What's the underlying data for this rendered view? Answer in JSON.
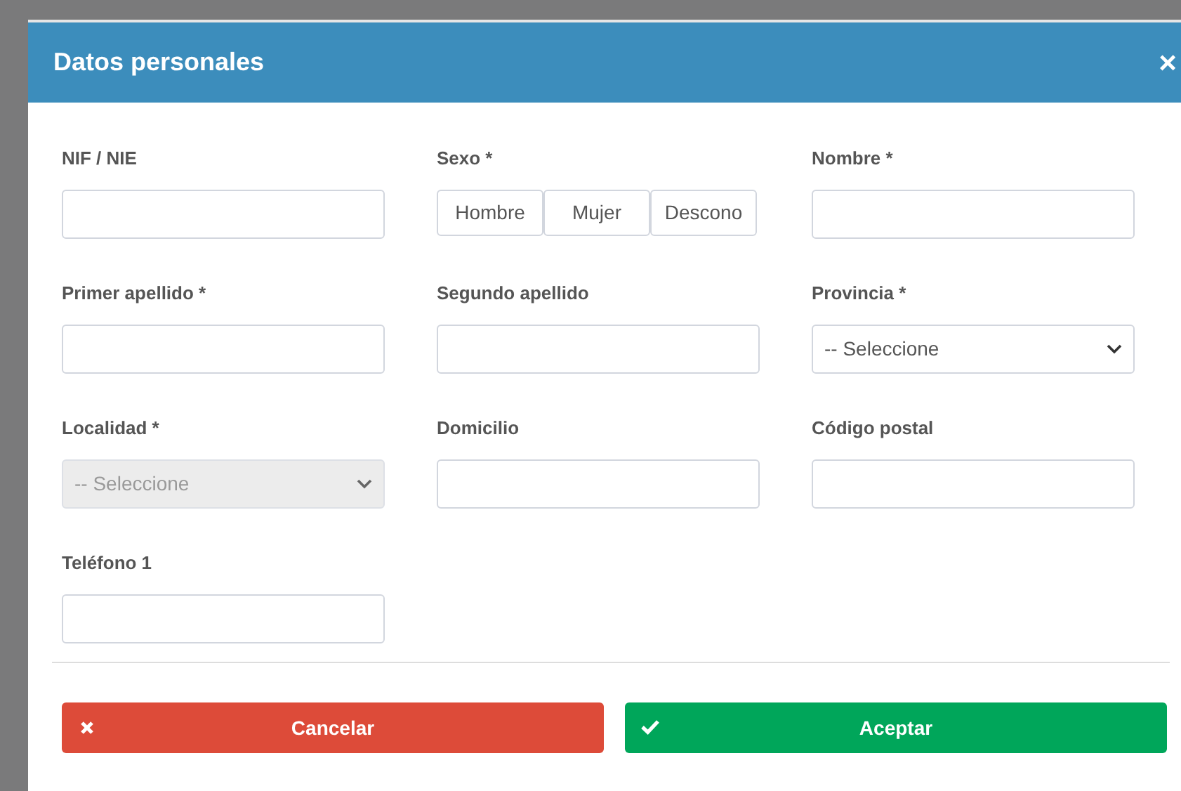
{
  "dialog": {
    "title": "Datos personales",
    "close": "×"
  },
  "fields": [
    {
      "kind": "text",
      "label": "NIF / NIE",
      "disabled": false
    },
    {
      "kind": "toggle",
      "label": "Sexo *",
      "options": [
        {
          "label": "Hombre",
          "selected": false
        },
        {
          "label": "Mujer",
          "selected": false
        },
        {
          "label": "Descono",
          "selected": false
        }
      ]
    },
    {
      "kind": "text",
      "label": "Nombre *",
      "disabled": false
    },
    {
      "kind": "text",
      "label": "Primer apellido *",
      "disabled": false
    },
    {
      "kind": "text",
      "label": "Segundo apellido",
      "disabled": false
    },
    {
      "kind": "select",
      "label": "Provincia *",
      "value": "-- Seleccione",
      "disabled": false
    },
    {
      "kind": "select",
      "label": "Localidad *",
      "value": "-- Seleccione",
      "disabled": true
    },
    {
      "kind": "text",
      "label": "Domicilio",
      "disabled": false
    },
    {
      "kind": "text",
      "label": "Código postal",
      "disabled": false
    },
    {
      "kind": "text",
      "label": "Teléfono 1",
      "disabled": false
    }
  ],
  "buttons": [
    {
      "kind": "cancel",
      "label": "Cancelar"
    },
    {
      "kind": "accept",
      "label": "Aceptar"
    }
  ]
}
